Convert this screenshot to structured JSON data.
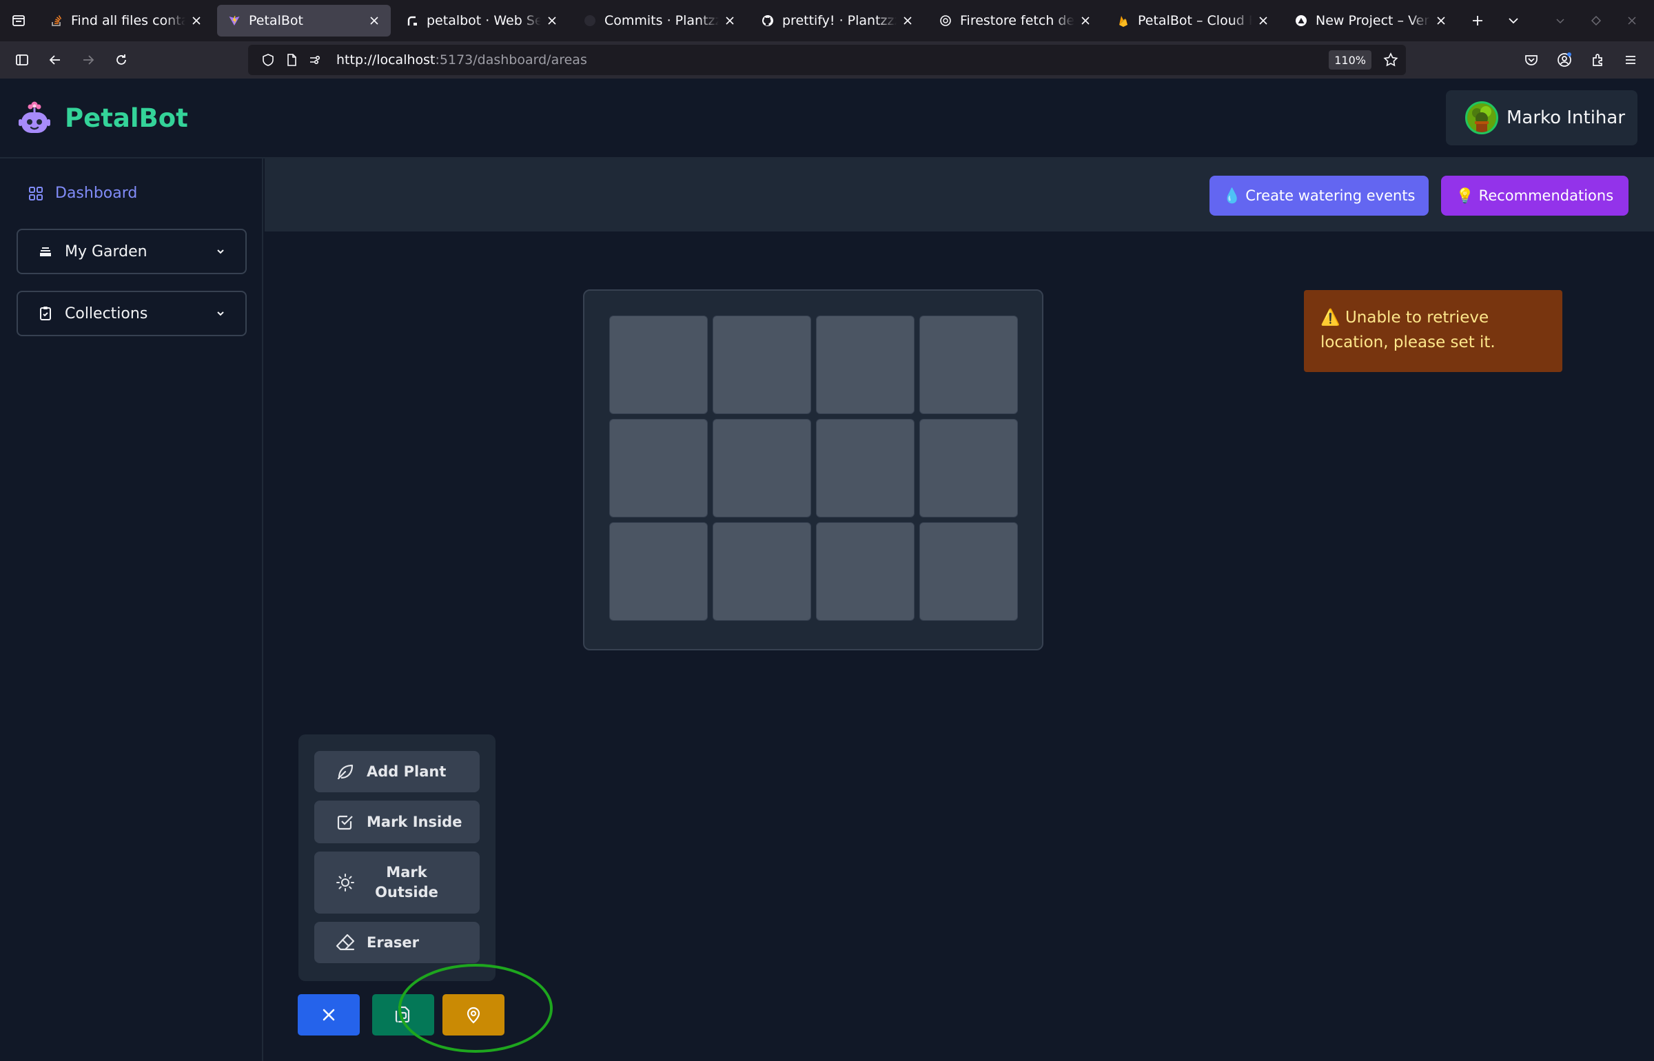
{
  "browser": {
    "tabs": [
      {
        "title": "Find all files containing",
        "icon": "stackoverflow-icon",
        "active": false
      },
      {
        "title": "PetalBot",
        "icon": "vite-icon",
        "active": true
      },
      {
        "title": "petalbot · Web Service",
        "icon": "render-icon",
        "active": false
      },
      {
        "title": "Commits · Plantzzzz/f",
        "icon": "github-icon",
        "active": false
      },
      {
        "title": "prettify! · Plantzzzz/fr",
        "icon": "github-icon",
        "active": false
      },
      {
        "title": "Firestore fetch debug",
        "icon": "chatgpt-icon",
        "active": false
      },
      {
        "title": "PetalBot – Cloud Fires",
        "icon": "firebase-icon",
        "active": false
      },
      {
        "title": "New Project – Vercel",
        "icon": "vercel-icon",
        "active": false
      }
    ],
    "url_host": "http://localhost",
    "url_path": ":5173/dashboard/areas",
    "zoom": "110%"
  },
  "app": {
    "name": "PetalBot",
    "brand_color": "#34d399",
    "user_name": "Marko Intihar"
  },
  "sidebar": {
    "dashboard_label": "Dashboard",
    "groups": [
      {
        "label": "My Garden",
        "icon": "layers-icon"
      },
      {
        "label": "Collections",
        "icon": "clipboard-icon"
      }
    ]
  },
  "actions": {
    "water_label": "💧 Create watering events",
    "recommend_label": "💡 Recommendations"
  },
  "grid": {
    "rows": 3,
    "cols": 4
  },
  "alert": {
    "text": "⚠️ Unable to retrieve location, please set it."
  },
  "tools": {
    "add_plant": "Add Plant",
    "mark_inside": "Mark Inside",
    "mark_outside": "Mark Outside",
    "eraser": "Eraser"
  },
  "bottom_buttons": [
    {
      "name": "close",
      "icon": "close-icon",
      "color": "#2563eb"
    },
    {
      "name": "save",
      "icon": "save-icon",
      "color": "#047857"
    },
    {
      "name": "set-location",
      "icon": "map-pin-icon",
      "color": "#ca8a04"
    }
  ]
}
